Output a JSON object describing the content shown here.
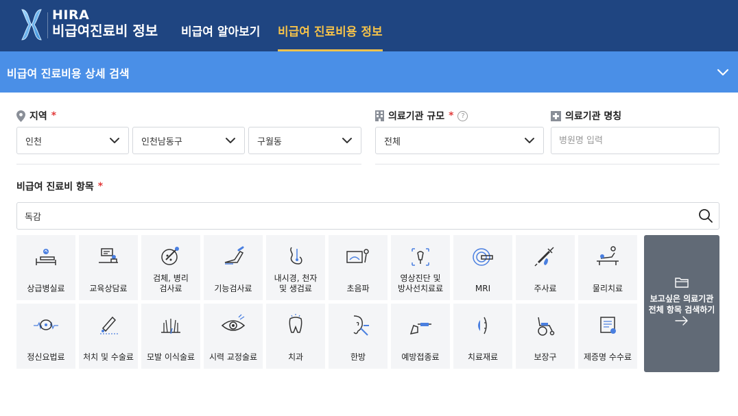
{
  "header": {
    "logo_line1": "HIRA",
    "logo_line2": "비급여진료비 정보",
    "nav": [
      {
        "label": "비급여 알아보기",
        "active": false
      },
      {
        "label": "비급여 진료비용 정보",
        "active": true
      }
    ]
  },
  "section": {
    "title": "비급여 진료비용 상세 검색"
  },
  "region": {
    "label": "지역",
    "required_mark": "*",
    "sido": "인천",
    "sigungu": "인천남동구",
    "dong": "구월동"
  },
  "scale": {
    "label": "의료기관 규모",
    "required_mark": "*",
    "help": "?",
    "value": "전체"
  },
  "hospital_name": {
    "label": "의료기관 명칭",
    "placeholder": "병원명 입력"
  },
  "items": {
    "label": "비급여 진료비 항목",
    "required_mark": "*",
    "search_value": "독감",
    "categories": [
      {
        "label": "상급병실료",
        "icon": "hospital-bed-icon"
      },
      {
        "label": "교육상담료",
        "icon": "counseling-desk-icon"
      },
      {
        "label": "검체, 병리\n검사료",
        "icon": "specimen-test-icon"
      },
      {
        "label": "기능검사료",
        "icon": "function-test-icon"
      },
      {
        "label": "내시경, 천자\n및 생검료",
        "icon": "endoscope-icon"
      },
      {
        "label": "초음파",
        "icon": "ultrasound-icon"
      },
      {
        "label": "영상진단 및\n방사선치료료",
        "icon": "xray-icon"
      },
      {
        "label": "MRI",
        "icon": "mri-icon"
      },
      {
        "label": "주사료",
        "icon": "syringe-icon"
      },
      {
        "label": "물리치료",
        "icon": "physical-therapy-icon"
      },
      {
        "label": "정신요법료",
        "icon": "brain-icon"
      },
      {
        "label": "처치 및 수술료",
        "icon": "surgery-icon"
      },
      {
        "label": "모발 이식술료",
        "icon": "hair-transplant-icon"
      },
      {
        "label": "시력 교정술료",
        "icon": "eye-icon"
      },
      {
        "label": "치과",
        "icon": "tooth-icon"
      },
      {
        "label": "한방",
        "icon": "acupuncture-icon"
      },
      {
        "label": "예방접종료",
        "icon": "vaccination-icon"
      },
      {
        "label": "치료재료",
        "icon": "medical-material-icon"
      },
      {
        "label": "보장구",
        "icon": "wheelchair-icon"
      },
      {
        "label": "제증명 수수료",
        "icon": "certificate-icon"
      }
    ],
    "all_search": {
      "line1": "보고싶은 의료기관",
      "line2": "전체 항목 검색하기",
      "arrow": "→"
    }
  },
  "colors": {
    "header_bg": "#1f4581",
    "bar_bg": "#4a8fe7",
    "nav_active": "#f5c24a",
    "required": "#e23b3b",
    "tile_bg": "#f4f5f7",
    "accent_icon": "#4a7fe0"
  }
}
